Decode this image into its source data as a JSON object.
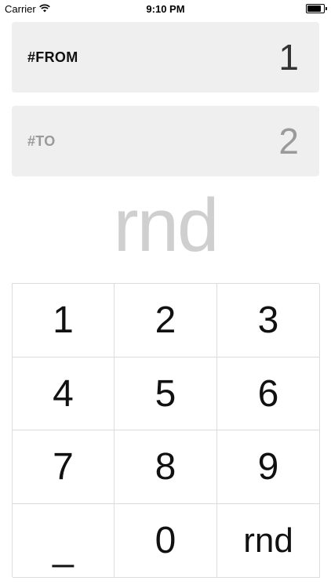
{
  "status_bar": {
    "carrier": "Carrier",
    "time": "9:10 PM",
    "wifi_icon": "wifi-icon",
    "battery_icon": "battery-icon"
  },
  "from_field": {
    "label": "#FROM",
    "value": "1"
  },
  "to_field": {
    "label": "#TO",
    "value": "2"
  },
  "result": {
    "text": "rnd"
  },
  "keypad": {
    "keys": [
      "1",
      "2",
      "3",
      "4",
      "5",
      "6",
      "7",
      "8",
      "9",
      "_",
      "0",
      "rnd"
    ]
  },
  "colors": {
    "field_background": "#efefef",
    "active_text": "#111111",
    "inactive_text": "#9a9a9a",
    "result_text": "#cfcfcf",
    "grid_line": "#dcdcdc"
  }
}
